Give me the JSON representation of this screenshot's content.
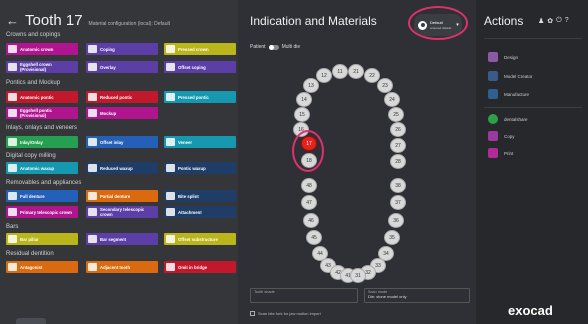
{
  "header": {
    "back_icon": "←",
    "title": "Tooth 17",
    "material_config": "Material configuration (local): Default"
  },
  "sections": {
    "crowns": "Crowns and copings",
    "pontics": "Pontics and Mockup",
    "inlays": "Inlays, onlays and veneers",
    "digital": "Digital copy milling",
    "removables": "Removables and appliances",
    "bars": "Bars",
    "residual": "Residual dentition"
  },
  "buttons": {
    "anatomic_crown": "Anatomic crown",
    "coping": "Coping",
    "pressed_crown": "Pressed crown",
    "eggshell_crown": "Eggshell crown (Provisional)",
    "overlay": "Overlay",
    "offset_coping": "Offset coping",
    "anatomic_pontic": "Anatomic pontic",
    "reduced_pontic": "Reduced pontic",
    "pressed_pontic": "Pressed pontic",
    "eggshell_pontic": "Eggshell pontic (Provisional)",
    "mockup": "Mockup",
    "inlay_onlay": "Inlay/Onlay",
    "offset_inlay": "Offset inlay",
    "veneer": "Veneer",
    "anatomic_waxup": "Anatomic waxup",
    "reduced_waxup": "Reduced waxup",
    "pontic_waxup": "Pontic waxup",
    "full_denture": "Full denture",
    "partial_denture": "Partial denture",
    "bite_splint": "Bite splint",
    "primary_telescopic": "Primary telescopic crown",
    "secondary_telescopic": "Secondary telescopic crown",
    "attachment": "Attachment",
    "bar_pillar": "Bar pillar",
    "bar_segment": "Bar segment",
    "offset_substructure": "Offset substructure",
    "antagonist": "Antagonist",
    "adjacent_tooth": "Adjacent tooth",
    "omit_in_bridge": "Omit in bridge"
  },
  "middle": {
    "title": "Indication and Materials",
    "patient_label": "Patient",
    "multi_die": "Multi die",
    "default_label": "Default",
    "default_sub": "scanned default",
    "tooth_shade_label": "Tooth shade",
    "tooth_shade_value": "",
    "scan_mode_label": "Scan mode",
    "scan_mode_value": "Die: stone model only",
    "scan_bite_fork": "Scan bite fork for jaw motion import"
  },
  "teeth": {
    "t11": "11",
    "t12": "12",
    "t13": "13",
    "t14": "14",
    "t15": "15",
    "t16": "16",
    "t17": "17",
    "t18": "18",
    "t21": "21",
    "t22": "22",
    "t23": "23",
    "t24": "24",
    "t25": "25",
    "t26": "26",
    "t27": "27",
    "t28": "28",
    "t31": "31",
    "t32": "32",
    "t33": "33",
    "t34": "34",
    "t35": "35",
    "t36": "36",
    "t37": "37",
    "t38": "38",
    "t41": "41",
    "t42": "42",
    "t43": "43",
    "t44": "44",
    "t45": "45",
    "t46": "46",
    "t47": "47",
    "t48": "48"
  },
  "right": {
    "title": "Actions",
    "design": "Design",
    "model_creator": "Model Creator",
    "manufacture": "Manufacture",
    "dentalshare": "dentalshare",
    "copy": "Copy",
    "print": "Print",
    "logo": "exocad"
  },
  "colors": {
    "magenta": "#b0158f",
    "purple": "#5b3fa6",
    "yellow": "#b9b51a",
    "red": "#c2182b",
    "teal": "#1598b0",
    "green": "#25a050",
    "blue": "#2460b7",
    "orange": "#d96a0f",
    "navy": "#1f3d66",
    "selected_tooth": "#e3231d",
    "highlight": "#e0306b"
  }
}
